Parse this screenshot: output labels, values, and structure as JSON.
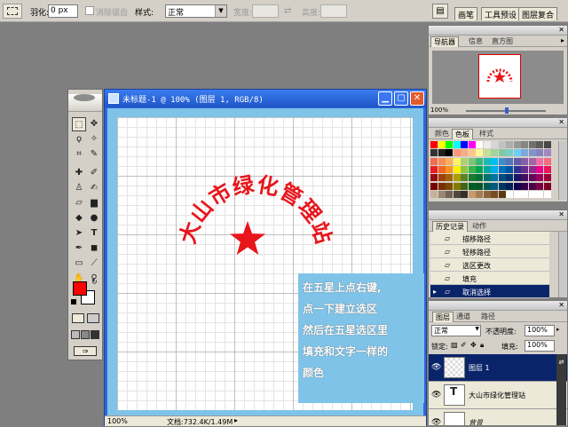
{
  "options_bar": {
    "feather_label": "羽化:",
    "feather_value": "0 px",
    "antialias_label": "消除锯齿",
    "style_label": "样式:",
    "style_value": "正常",
    "width_label": "宽度:",
    "height_label": "高度:",
    "palette_well_tabs": [
      "画笔",
      "工具预设",
      "图层复合"
    ]
  },
  "document": {
    "title": "未标题-1 @ 100% (图层 1, RGB/8)",
    "zoom": "100%",
    "doc_size": "文档:732.4K/1.49M"
  },
  "canvas": {
    "arc_text": "大山市绿化管理站",
    "arc_chars": [
      "大",
      "山",
      "市",
      "绿",
      "化",
      "管",
      "理",
      "站"
    ],
    "star_color": "#e8151b",
    "text_color": "#e8151b"
  },
  "annotation": {
    "lines": [
      "在五星上点右键,",
      "点一下建立选区",
      "然后在五星选区里",
      "填充和文字一样的",
      "颜色"
    ]
  },
  "navigator": {
    "tabs": [
      "导航器",
      "信息",
      "直方图"
    ],
    "zoom": "100%"
  },
  "color_panel": {
    "tabs": [
      "颜色",
      "色板",
      "样式"
    ]
  },
  "history": {
    "tabs": [
      "历史记录",
      "动作"
    ],
    "items": [
      "描移路径",
      "轻移路径",
      "选区更改",
      "填充",
      "取消选择"
    ],
    "selected_index": 4
  },
  "layers": {
    "tabs": [
      "图层",
      "通道",
      "路径"
    ],
    "blend_mode": "正常",
    "opacity_label": "不透明度:",
    "opacity_value": "100%",
    "lock_label": "锁定:",
    "fill_label": "填充:",
    "fill_value": "100%",
    "items": [
      "图层 1",
      "大山市绿化管理站",
      "背景"
    ],
    "selected_index": 0
  },
  "colors": {
    "foreground": "#ff0000",
    "background": "#ffffff",
    "title_blue": "#2f66d8",
    "canvas_border": "#7fc3e8"
  }
}
